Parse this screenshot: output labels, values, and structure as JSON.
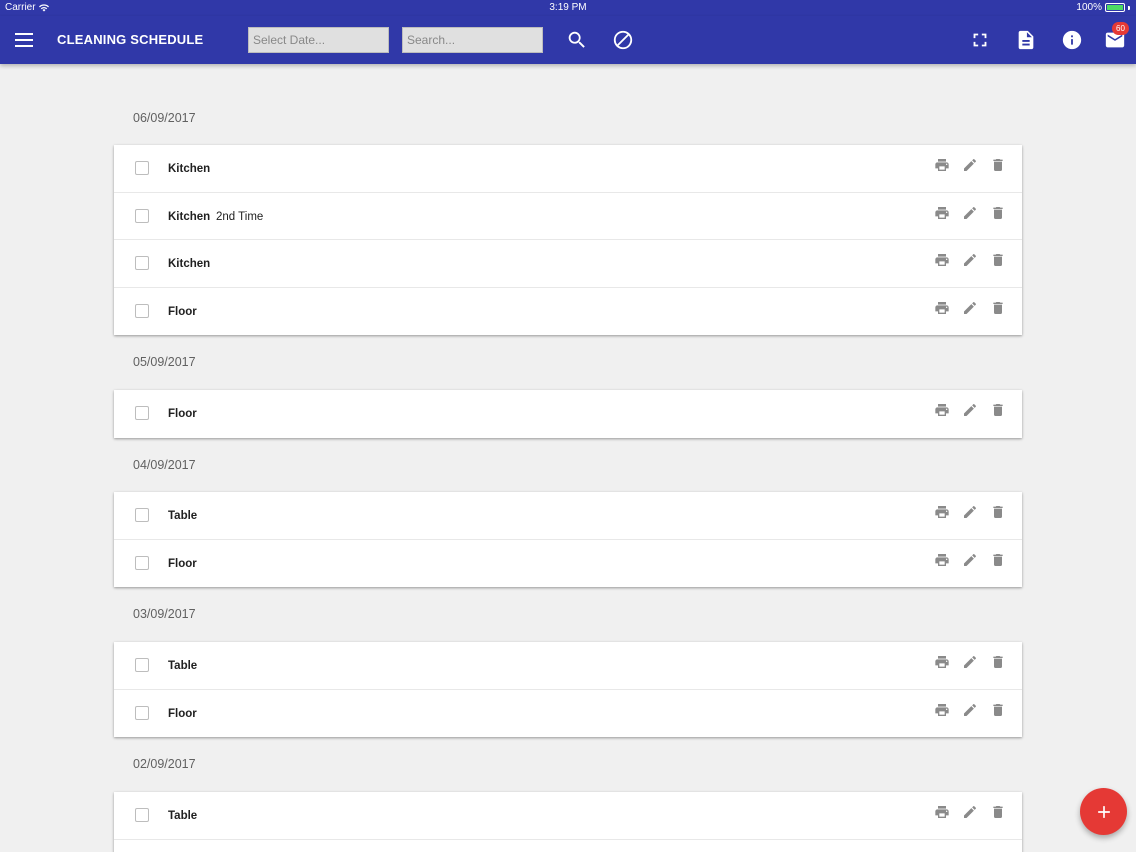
{
  "status_bar": {
    "carrier": "Carrier",
    "time": "3:19 PM",
    "battery": "100%"
  },
  "app_bar": {
    "title": "CLEANING SCHEDULE",
    "date_placeholder": "Select Date...",
    "search_placeholder": "Search...",
    "badge_count": "60",
    "color": "#3038a8"
  },
  "groups": [
    {
      "date": "06/09/2017",
      "items": [
        {
          "title": "Kitchen",
          "subtitle": ""
        },
        {
          "title": "Kitchen",
          "subtitle": "2nd Time"
        },
        {
          "title": "Kitchen",
          "subtitle": ""
        },
        {
          "title": "Floor",
          "subtitle": ""
        }
      ]
    },
    {
      "date": "05/09/2017",
      "items": [
        {
          "title": "Floor",
          "subtitle": ""
        }
      ]
    },
    {
      "date": "04/09/2017",
      "items": [
        {
          "title": "Table",
          "subtitle": ""
        },
        {
          "title": "Floor",
          "subtitle": ""
        }
      ]
    },
    {
      "date": "03/09/2017",
      "items": [
        {
          "title": "Table",
          "subtitle": ""
        },
        {
          "title": "Floor",
          "subtitle": ""
        }
      ]
    },
    {
      "date": "02/09/2017",
      "items": [
        {
          "title": "Table",
          "subtitle": ""
        },
        {
          "title": "",
          "subtitle": ""
        }
      ]
    }
  ],
  "icons": {
    "menu": "menu-icon",
    "search": "search-icon",
    "clear": "block-icon",
    "fullscreen": "fullscreen-icon",
    "document": "document-icon",
    "info": "info-icon",
    "mail": "mail-icon",
    "row_print": "print-icon",
    "row_edit": "edit-icon",
    "row_delete": "delete-icon",
    "fab": "add-icon"
  },
  "fab_color": "#e53935"
}
